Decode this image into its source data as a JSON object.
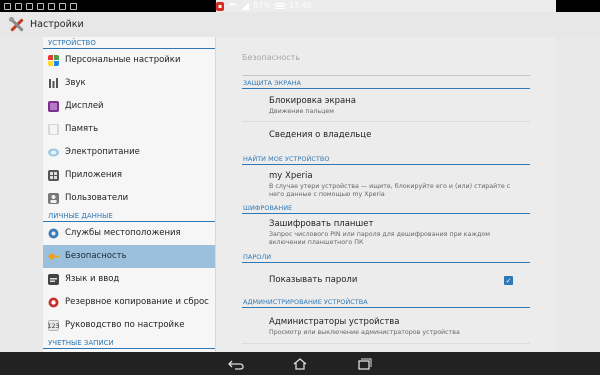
{
  "status_bar": {
    "battery_percent": "97%",
    "time": "17:45"
  },
  "action_bar": {
    "title": "Настройки"
  },
  "sidebar": {
    "sections": [
      {
        "header": "УСТРОЙСТВО",
        "items": [
          {
            "label": "Персональные настройки",
            "icon": "personalization-icon"
          },
          {
            "label": "Звук",
            "icon": "sound-icon"
          },
          {
            "label": "Дисплей",
            "icon": "display-icon"
          },
          {
            "label": "Память",
            "icon": "storage-icon"
          },
          {
            "label": "Электропитание",
            "icon": "power-icon"
          },
          {
            "label": "Приложения",
            "icon": "apps-icon"
          },
          {
            "label": "Пользователи",
            "icon": "users-icon"
          }
        ]
      },
      {
        "header": "ЛИЧНЫЕ ДАННЫЕ",
        "items": [
          {
            "label": "Службы местоположения",
            "icon": "location-icon"
          },
          {
            "label": "Безопасность",
            "icon": "security-icon",
            "selected": true
          },
          {
            "label": "Язык и ввод",
            "icon": "language-icon"
          },
          {
            "label": "Резервное копирование и сброс",
            "icon": "backup-icon"
          },
          {
            "label": "Руководство по настройке",
            "icon": "setup-guide-icon"
          }
        ]
      },
      {
        "header": "УЧЕТНЫЕ ЗАПИСИ",
        "items": []
      }
    ]
  },
  "detail": {
    "title": "Безопасность",
    "groups": [
      {
        "header": "ЗАЩИТА ЭКРАНА",
        "prefs": [
          {
            "title": "Блокировка экрана",
            "summary": "Движение пальцем"
          },
          {
            "title": "Сведения о владельце",
            "summary": ""
          }
        ]
      },
      {
        "header": "НАЙТИ МОЕ УСТРОЙСТВО",
        "prefs": [
          {
            "title": "my Xperia",
            "summary": "В случае утери устройства — ищите, блокируйте его и (или) стирайте с него данные с помощью my Xperia"
          }
        ]
      },
      {
        "header": "ШИФРОВАНИЕ",
        "prefs": [
          {
            "title": "Зашифровать планшет",
            "summary": "Запрос числового PIN или пароля для дешифрования при каждом включении планшетного ПК"
          }
        ]
      },
      {
        "header": "ПАРОЛИ",
        "prefs": [
          {
            "title": "Показывать пароли",
            "summary": "",
            "checked": true
          }
        ]
      },
      {
        "header": "АДМИНИСТРИРОВАНИЕ УСТРОЙСТВА",
        "prefs": [
          {
            "title": "Администраторы устройства",
            "summary": "Просмотр или выключение администраторов устройства"
          }
        ]
      }
    ]
  },
  "colors": {
    "accent": "#2f78b6",
    "selected_bg": "#9bc0dd"
  }
}
